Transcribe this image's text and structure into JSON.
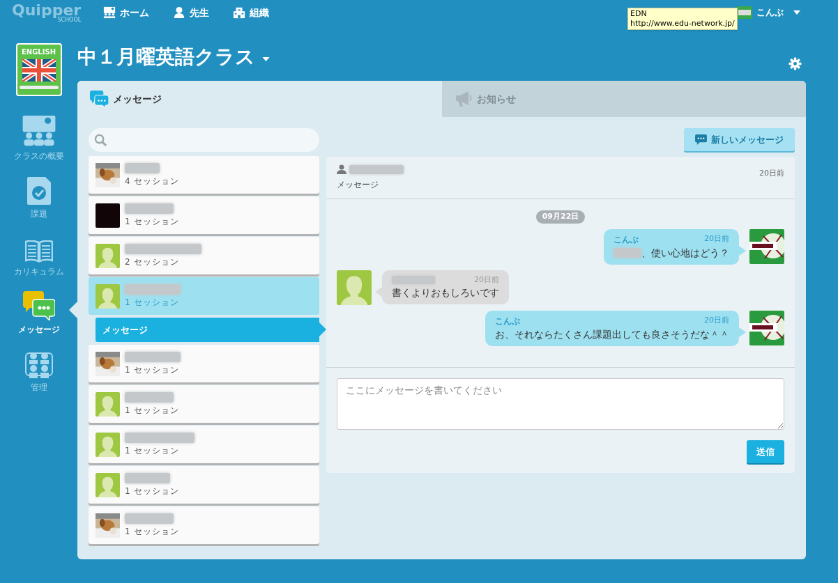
{
  "topbar": {
    "logo": "Quipper",
    "logo_sub": "SCHOOL",
    "nav": [
      {
        "label": "ホーム"
      },
      {
        "label": "先生"
      },
      {
        "label": "組織"
      }
    ],
    "user": "こんぶ",
    "tooltip": {
      "title": "EDN",
      "url": "http://www.edu-network.jp/"
    }
  },
  "class": {
    "badge": "ENGLISH",
    "title": "中１月曜英語クラス"
  },
  "sidebar": {
    "items": [
      {
        "label": "クラスの概要",
        "selected": false
      },
      {
        "label": "課題",
        "selected": false
      },
      {
        "label": "カリキュラム",
        "selected": false
      },
      {
        "label": "メッセージ",
        "selected": true
      },
      {
        "label": "管理",
        "selected": false
      }
    ]
  },
  "tabs": [
    {
      "label": "メッセージ",
      "selected": true
    },
    {
      "label": "お知らせ",
      "selected": false
    }
  ],
  "new_message_button": "新しいメッセージ",
  "conversations": [
    {
      "kind": "picture",
      "sessions": "4 セッション",
      "selected": false
    },
    {
      "kind": "dark",
      "sessions": "1 セッション",
      "selected": false
    },
    {
      "kind": "silhouette",
      "sessions": "2 セッション",
      "selected": false
    },
    {
      "kind": "silhouette",
      "sessions": "1 セッション",
      "selected": true,
      "children": [
        {
          "label": "メッセージ",
          "selected": true
        }
      ]
    },
    {
      "kind": "picture",
      "sessions": "1 セッション",
      "selected": false
    },
    {
      "kind": "silhouette",
      "sessions": "1 セッション",
      "selected": false
    },
    {
      "kind": "silhouette",
      "sessions": "1 セッション",
      "selected": false
    },
    {
      "kind": "silhouette",
      "sessions": "1 セッション",
      "selected": false
    },
    {
      "kind": "picture",
      "sessions": "1 セッション",
      "selected": false
    }
  ],
  "thread": {
    "subject": "メッセージ",
    "time": "20日前",
    "date": "09月22日",
    "messages": [
      {
        "kind": "sent",
        "author": "こんぶ",
        "time": "20日前",
        "redacted_prefix": true,
        "text": "、使い心地はどう？"
      },
      {
        "kind": "received",
        "time": "20日前",
        "redacted_prefix": false,
        "text": "書くよりおもしろいです"
      },
      {
        "kind": "sent",
        "author": "こんぶ",
        "time": "20日前",
        "redacted_prefix": false,
        "text": "お、それならたくさん課題出しても良さそうだな＾＾"
      }
    ],
    "composer": {
      "placeholder": "ここにメッセージを書いてください",
      "send": "送信"
    }
  }
}
